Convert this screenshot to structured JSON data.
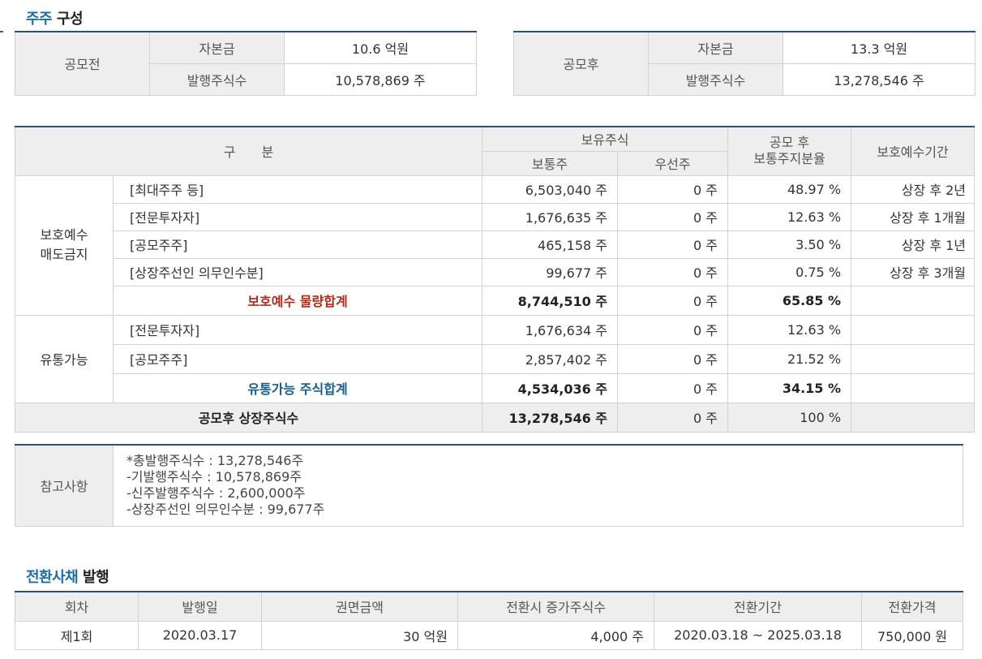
{
  "shareholders": {
    "title_accent": "주주",
    "title_rest": " 구성",
    "before": {
      "label": "공모전",
      "capital_label": "자본금",
      "capital_value": "10.6 억원",
      "shares_label": "발행주식수",
      "shares_value": "10,578,869 주"
    },
    "after": {
      "label": "공모후",
      "capital_label": "자본금",
      "capital_value": "13.3 억원",
      "shares_label": "발행주식수",
      "shares_value": "13,278,546 주"
    }
  },
  "holdings": {
    "headers": {
      "category": "구　　분",
      "held_shares": "보유주식",
      "common": "보통주",
      "preferred": "우선주",
      "ratio_line1": "공모 후",
      "ratio_line2": "보통주지분율",
      "lockup": "보호예수기간"
    },
    "group_locked": {
      "line1": "보호예수",
      "line2": "매도금지"
    },
    "locked_rows": [
      {
        "name": "[최대주주 등]",
        "common": "6,503,040 주",
        "preferred": "0 주",
        "ratio": "48.97 %",
        "period": "상장 후 2년"
      },
      {
        "name": "[전문투자자]",
        "common": "1,676,635 주",
        "preferred": "0 주",
        "ratio": "12.63 %",
        "period": "상장 후 1개월"
      },
      {
        "name": "[공모주주]",
        "common": "465,158 주",
        "preferred": "0 주",
        "ratio": "3.50 %",
        "period": "상장 후 1년"
      },
      {
        "name": "[상장주선인 의무인수분]",
        "common": "99,677 주",
        "preferred": "0 주",
        "ratio": "0.75 %",
        "period": "상장 후 3개월"
      }
    ],
    "locked_total": {
      "name": "보호예수 물량합계",
      "common": "8,744,510 주",
      "preferred": "0 주",
      "ratio": "65.85 %"
    },
    "group_tradable": "유통가능",
    "tradable_rows": [
      {
        "name": "[전문투자자]",
        "common": "1,676,634 주",
        "preferred": "0 주",
        "ratio": "12.63 %"
      },
      {
        "name": "[공모주주]",
        "common": "2,857,402 주",
        "preferred": "0 주",
        "ratio": "21.52 %"
      }
    ],
    "tradable_total": {
      "name": "유통가능 주식합계",
      "common": "4,534,036 주",
      "preferred": "0 주",
      "ratio": "34.15 %"
    },
    "grand_total": {
      "name": "공모후 상장주식수",
      "common": "13,278,546 주",
      "preferred": "0 주",
      "ratio": "100 %"
    }
  },
  "reference": {
    "label": "참고사항",
    "lines": [
      "*총발행주식수 : 13,278,546주",
      "-기발행주식수 : 10,578,869주",
      "-신주발행주식수 : 2,600,000주",
      "-상장주선인 의무인수분 : 99,677주"
    ]
  },
  "bonds": {
    "title_accent": "전환사채",
    "title_rest": " 발행",
    "headers": [
      "회차",
      "발행일",
      "권면금액",
      "전환시 증가주식수",
      "전환기간",
      "전환가격"
    ],
    "row": {
      "round": "제1회",
      "issue_date": "2020.03.17",
      "face_amount": "30 억원",
      "added_shares": "4,000 주",
      "period": "2020.03.18 ~ 2025.03.18",
      "price": "750,000 원"
    }
  }
}
